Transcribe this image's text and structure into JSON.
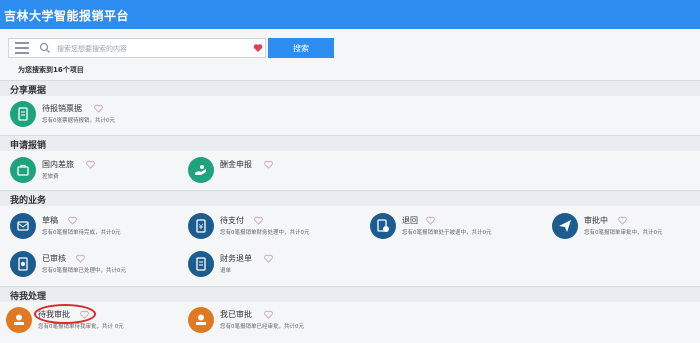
{
  "header": {
    "title": "吉林大学智能报销平台"
  },
  "search": {
    "placeholder": "搜索您想要搜索的内容",
    "button_label": "搜索"
  },
  "results": {
    "count_text": "为您搜索到16个项目"
  },
  "colors": {
    "accent": "#2d8cf0",
    "teal": "#1fa37f",
    "navy": "#1c5c8e",
    "orange": "#e07a22",
    "highlight": "#d92b2b"
  },
  "sections": {
    "share": {
      "title": "分享票据",
      "items": [
        {
          "title": "待报销票据",
          "desc": "您有0张票据待报销，共计0元",
          "icon": "receipt-icon"
        }
      ]
    },
    "apply": {
      "title": "申请报销",
      "items": [
        {
          "title": "国内差旅",
          "desc": "差旅费",
          "icon": "travel-icon"
        },
        {
          "title": "酬金申报",
          "desc": "",
          "icon": "reward-icon"
        }
      ]
    },
    "mine": {
      "title": "我的业务",
      "items": [
        {
          "title": "草稿",
          "desc": "您有0笔报销单待完成，共计0元",
          "icon": "draft-icon"
        },
        {
          "title": "待支付",
          "desc": "您有0笔报销单财务处理中，共计0元",
          "icon": "pay-icon"
        },
        {
          "title": "退回",
          "desc": "您有0笔报销单处于被退中，共计0元",
          "icon": "return-icon"
        },
        {
          "title": "审批中",
          "desc": "您有0笔报销单审批中，共计0元",
          "icon": "send-icon"
        },
        {
          "title": "已审核",
          "desc": "您有0笔报销单已处理中，共计0元",
          "icon": "audited-icon"
        },
        {
          "title": "财务退单",
          "desc": "退单",
          "icon": "finance-return-icon"
        }
      ]
    },
    "todo": {
      "title": "待我处理",
      "items": [
        {
          "title": "待我审批",
          "desc": "您有0笔报销单待我审批，共计 0元",
          "icon": "approve-icon"
        },
        {
          "title": "我已审批",
          "desc": "您有0笔报销单已经审批，共计0元",
          "icon": "approved-icon"
        }
      ]
    }
  }
}
